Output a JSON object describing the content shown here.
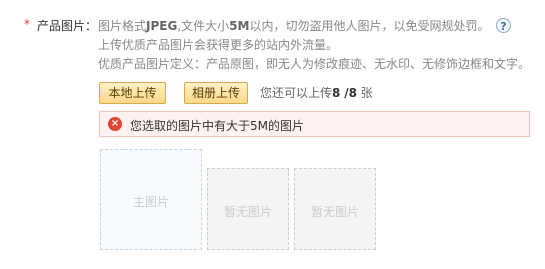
{
  "field": {
    "required_mark": "*",
    "label": "产品图片："
  },
  "hints": {
    "line1_prefix": "图片格式",
    "line1_format": "JPEG",
    "line1_mid": ",文件大小",
    "line1_size": "5M",
    "line1_suffix": "以内，切勿盗用他人图片，以免受网规处罚。",
    "line2": "上传优质产品图片会获得更多的站内外流量。",
    "line3": "优质产品图片定义：产品原图，即无人为修改痕迹、无水印、无修饰边框和文字。"
  },
  "help_icon": "?",
  "buttons": {
    "local_upload": "本地上传",
    "album_upload": "相册上传"
  },
  "upload_count": {
    "prefix": "您还可以上传",
    "current": "8",
    "total": "/8",
    "suffix": "张"
  },
  "error": {
    "icon": "×",
    "message": "您选取的图片中有大于5M的图片"
  },
  "thumbnails": [
    {
      "label": "主图片"
    },
    {
      "label": "暂无图片"
    },
    {
      "label": "暂无图片"
    }
  ]
}
